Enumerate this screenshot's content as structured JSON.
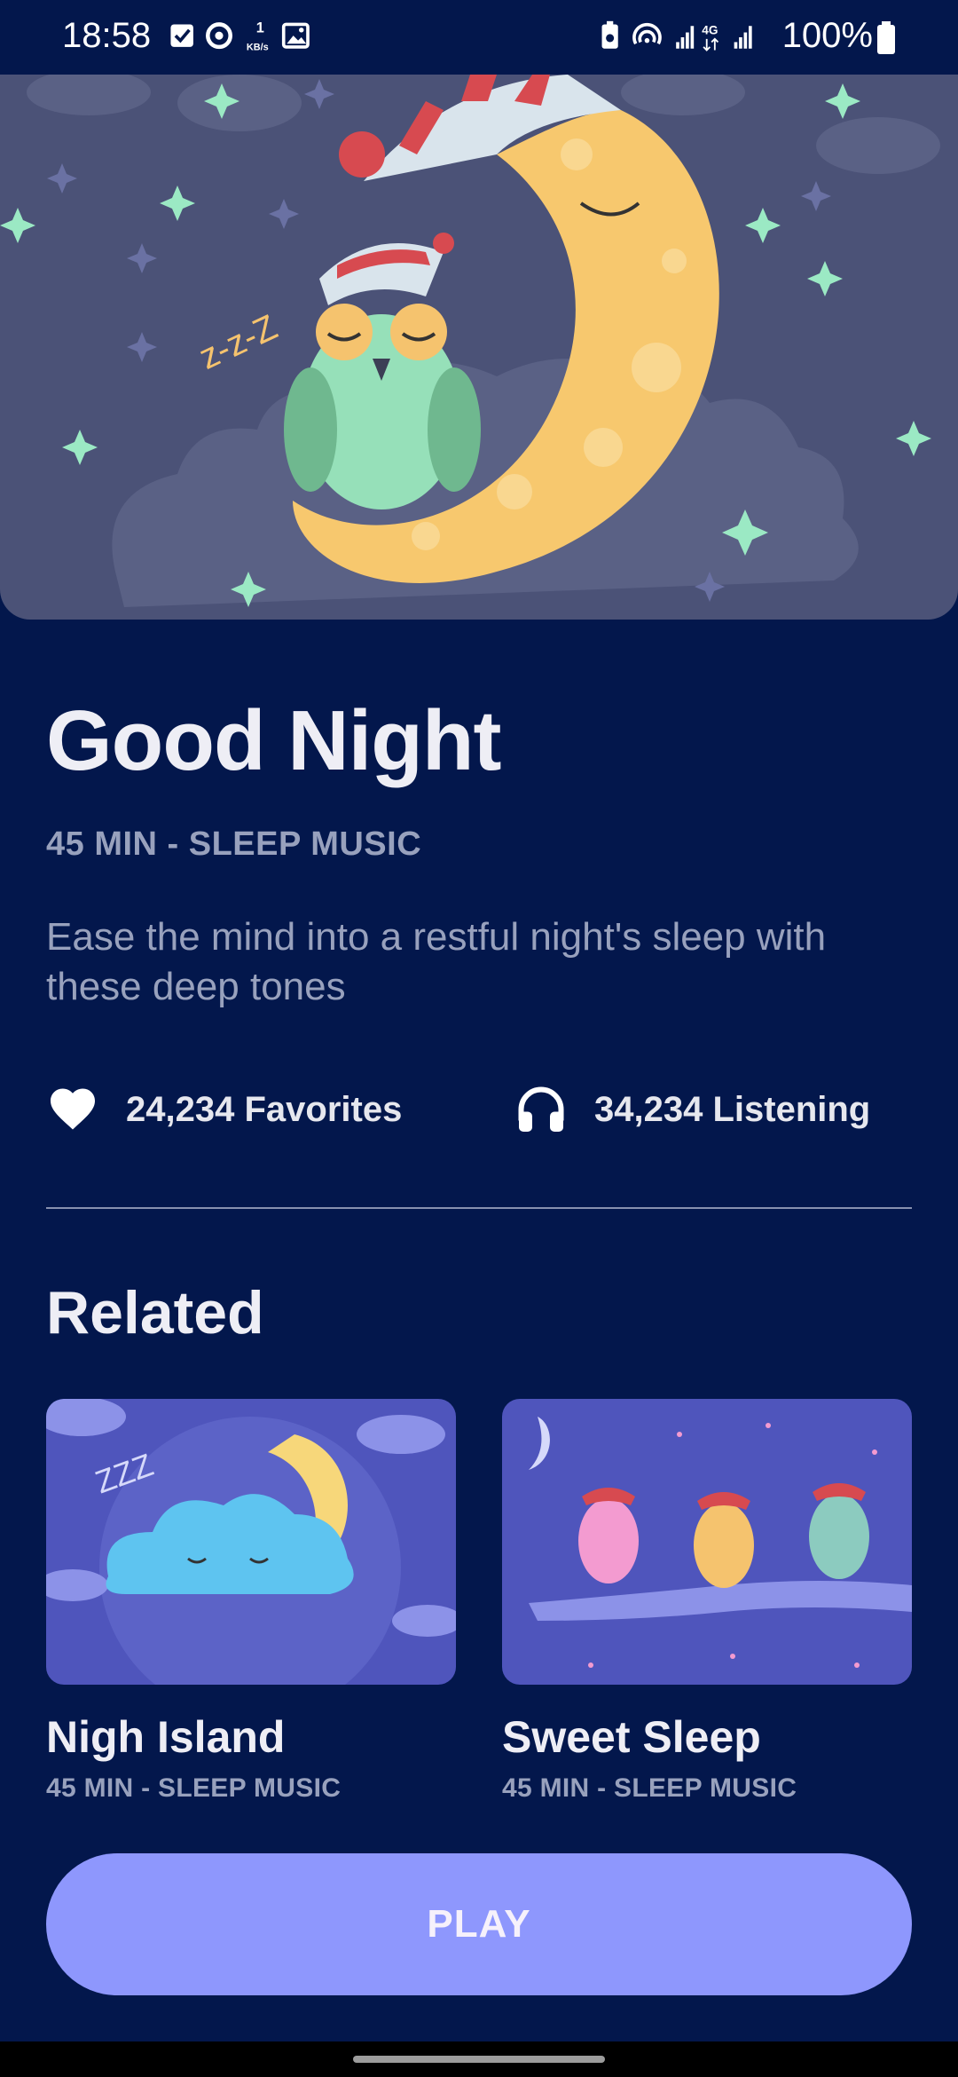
{
  "status_bar": {
    "time": "18:58",
    "speed": "1",
    "speed_unit": "KB/s",
    "network": "4G",
    "battery": "100%"
  },
  "track": {
    "title": "Good Night",
    "subtitle": "45 MIN - SLEEP MUSIC",
    "description": "Ease the mind into a restful night's sleep with these deep tones",
    "favorites": "24,234 Favorites",
    "listening": "34,234 Listening"
  },
  "related": {
    "heading": "Related",
    "items": [
      {
        "title": "Nigh Island",
        "subtitle": "45 MIN - SLEEP MUSIC"
      },
      {
        "title": "Sweet Sleep",
        "subtitle": "45 MIN - SLEEP MUSIC"
      }
    ]
  },
  "play_button": {
    "label": "PLAY"
  },
  "colors": {
    "background": "#03174C",
    "accent": "#8E97FD",
    "text_primary": "#EEEEF5",
    "text_secondary": "#98A1BD"
  },
  "icons": {
    "favorites": "heart-icon",
    "listening": "headphones-icon"
  }
}
